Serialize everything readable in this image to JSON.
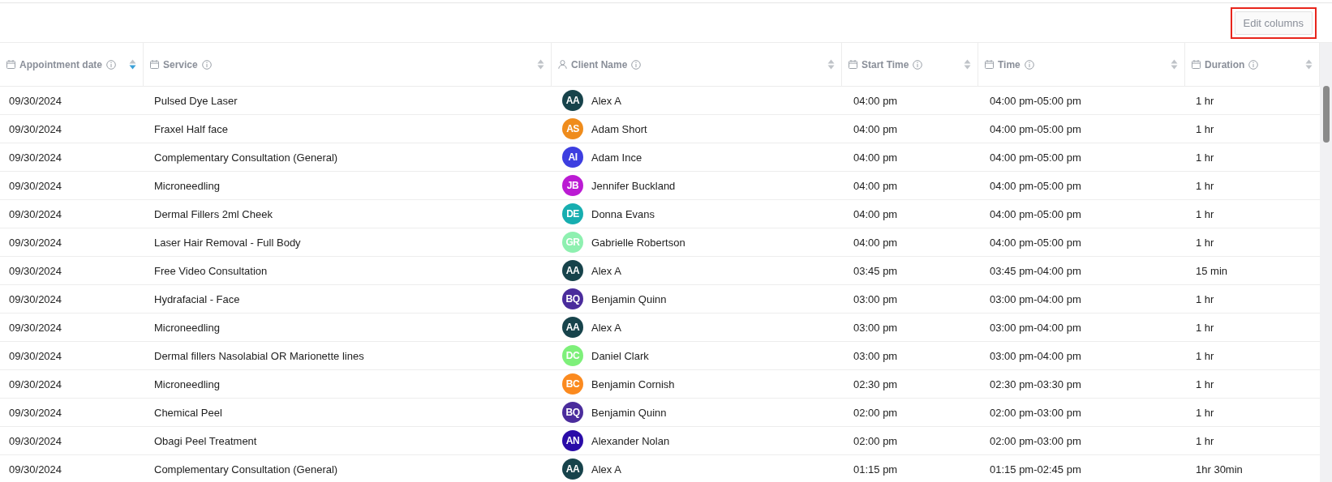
{
  "toolbar": {
    "edit_columns_button": {
      "label": "Edit columns",
      "highlighted": true
    }
  },
  "table": {
    "columns": [
      {
        "label": "Appointment date",
        "kind": "date",
        "sorted": true
      },
      {
        "label": "Service",
        "kind": "date",
        "sorted": false
      },
      {
        "label": "Client Name",
        "kind": "person",
        "sorted": false
      },
      {
        "label": "Start Time",
        "kind": "date",
        "sorted": false
      },
      {
        "label": "Time",
        "kind": "date",
        "sorted": false
      },
      {
        "label": "Duration",
        "kind": "date",
        "sorted": false
      }
    ],
    "rows": [
      {
        "date": "09/30/2024",
        "service": "Pulsed Dye Laser",
        "initials": "AA",
        "color": "#17434b",
        "client": "Alex A",
        "start": "04:00 pm",
        "time": "04:00 pm-05:00 pm",
        "duration": "1 hr"
      },
      {
        "date": "09/30/2024",
        "service": "Fraxel Half face",
        "initials": "AS",
        "color": "#ef8c1c",
        "client": "Adam Short",
        "start": "04:00 pm",
        "time": "04:00 pm-05:00 pm",
        "duration": "1 hr"
      },
      {
        "date": "09/30/2024",
        "service": "Complementary Consultation (General)",
        "initials": "AI",
        "color": "#3d3ee0",
        "client": "Adam Ince",
        "start": "04:00 pm",
        "time": "04:00 pm-05:00 pm",
        "duration": "1 hr"
      },
      {
        "date": "09/30/2024",
        "service": "Microneedling",
        "initials": "JB",
        "color": "#bb1bd3",
        "client": "Jennifer Buckland",
        "start": "04:00 pm",
        "time": "04:00 pm-05:00 pm",
        "duration": "1 hr"
      },
      {
        "date": "09/30/2024",
        "service": "Dermal Fillers 2ml Cheek",
        "initials": "DE",
        "color": "#17aeb0",
        "client": "Donna Evans",
        "start": "04:00 pm",
        "time": "04:00 pm-05:00 pm",
        "duration": "1 hr"
      },
      {
        "date": "09/30/2024",
        "service": "Laser Hair Removal - Full Body",
        "initials": "GR",
        "color": "#8ef0b0",
        "client": "Gabrielle Robertson",
        "start": "04:00 pm",
        "time": "04:00 pm-05:00 pm",
        "duration": "1 hr"
      },
      {
        "date": "09/30/2024",
        "service": "Free Video Consultation",
        "initials": "AA",
        "color": "#17434b",
        "client": "Alex A",
        "start": "03:45 pm",
        "time": "03:45 pm-04:00 pm",
        "duration": "15 min"
      },
      {
        "date": "09/30/2024",
        "service": "Hydrafacial - Face",
        "initials": "BQ",
        "color": "#4a2c9c",
        "client": "Benjamin Quinn",
        "start": "03:00 pm",
        "time": "03:00 pm-04:00 pm",
        "duration": "1 hr"
      },
      {
        "date": "09/30/2024",
        "service": "Microneedling",
        "initials": "AA",
        "color": "#17434b",
        "client": "Alex A",
        "start": "03:00 pm",
        "time": "03:00 pm-04:00 pm",
        "duration": "1 hr"
      },
      {
        "date": "09/30/2024",
        "service": "Dermal fillers Nasolabial OR Marionette lines",
        "initials": "DC",
        "color": "#7ef07a",
        "client": "Daniel Clark",
        "start": "03:00 pm",
        "time": "03:00 pm-04:00 pm",
        "duration": "1 hr"
      },
      {
        "date": "09/30/2024",
        "service": "Microneedling",
        "initials": "BC",
        "color": "#fb8a1f",
        "client": "Benjamin Cornish",
        "start": "02:30 pm",
        "time": "02:30 pm-03:30 pm",
        "duration": "1 hr"
      },
      {
        "date": "09/30/2024",
        "service": "Chemical Peel",
        "initials": "BQ",
        "color": "#4a2c9c",
        "client": "Benjamin Quinn",
        "start": "02:00 pm",
        "time": "02:00 pm-03:00 pm",
        "duration": "1 hr"
      },
      {
        "date": "09/30/2024",
        "service": "Obagi Peel Treatment",
        "initials": "AN",
        "color": "#2a0ca8",
        "client": "Alexander Nolan",
        "start": "02:00 pm",
        "time": "02:00 pm-03:00 pm",
        "duration": "1 hr"
      },
      {
        "date": "09/30/2024",
        "service": "Complementary Consultation (General)",
        "initials": "AA",
        "color": "#17434b",
        "client": "Alex A",
        "start": "01:15 pm",
        "time": "01:15 pm-02:45 pm",
        "duration": "1hr 30min"
      }
    ]
  }
}
